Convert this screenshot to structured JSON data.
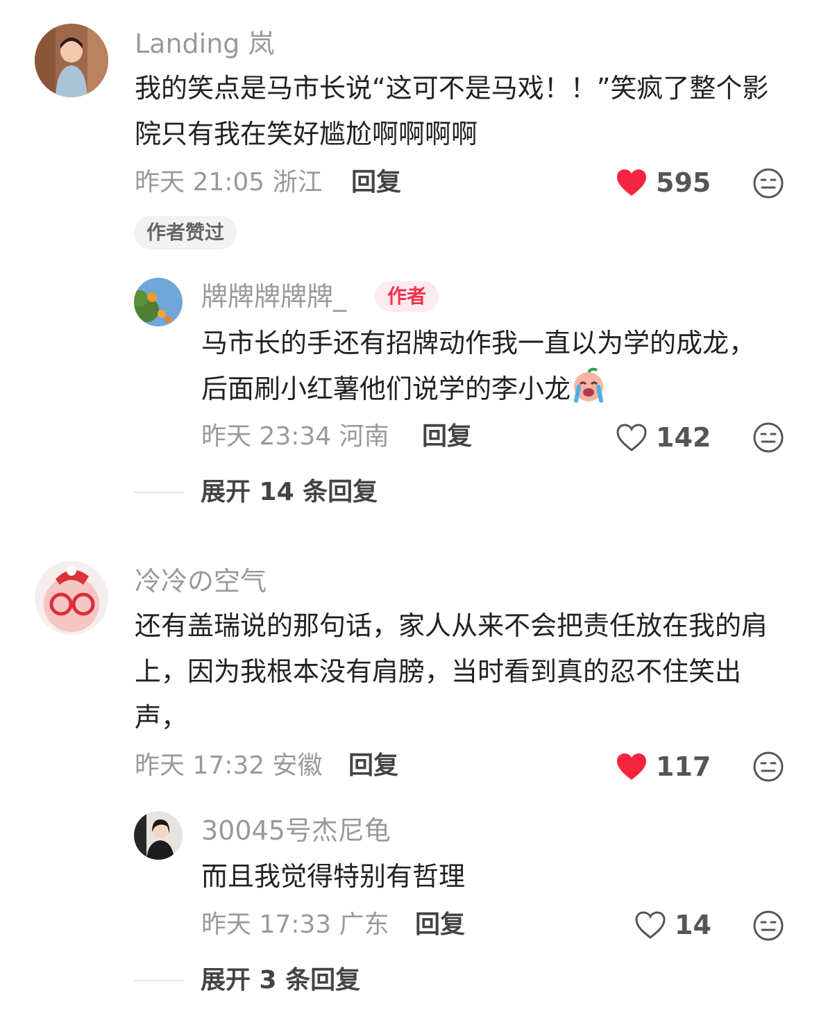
{
  "comments": [
    {
      "user": "Landing 岚",
      "text": "我的笑点是马市长说“这可不是马戏！！”笑疯了整个影院只有我在笑好尴尬啊啊啊啊",
      "time": "昨天 21:05",
      "location": "浙江",
      "reply_label": "回复",
      "likes": "595",
      "liked": true,
      "author_liked_badge": "作者赞过",
      "sub_reply": {
        "user": "牌牌牌牌牌_",
        "author_tag": "作者",
        "text": "马市长的手还有招牌动作我一直以为学的成龙，后面刷小红薯他们说学的李小龙",
        "emoji": "crying-face-emoji",
        "time": "昨天 23:34",
        "location": "河南",
        "reply_label": "回复",
        "likes": "142",
        "liked": false
      },
      "expand_label": "展开 14 条回复"
    },
    {
      "user": "冷冷の空气",
      "text": "还有盖瑞说的那句话，家人从来不会把责任放在我的肩上，因为我根本没有肩膀，当时看到真的忍不住笑出声，",
      "time": "昨天 17:32",
      "location": "安徽",
      "reply_label": "回复",
      "likes": "117",
      "liked": true,
      "sub_reply": {
        "user": "30045号杰尼龟",
        "text": "而且我觉得特别有哲理",
        "time": "昨天 17:33",
        "location": "广东",
        "reply_label": "回复",
        "likes": "14",
        "liked": false
      },
      "expand_label": "展开 3 条回复"
    }
  ],
  "colors": {
    "like_red": "#f5253f",
    "author_tag_bg": "#fdebee",
    "author_tag_text": "#f0324f",
    "muted_text": "#999999"
  }
}
